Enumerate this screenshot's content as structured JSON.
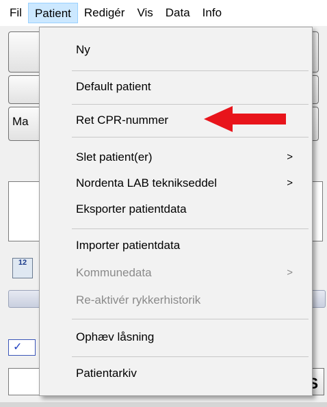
{
  "menubar": {
    "items": [
      {
        "label": "Fil"
      },
      {
        "label": "Patient"
      },
      {
        "label": "Redigér"
      },
      {
        "label": "Vis"
      },
      {
        "label": "Data"
      },
      {
        "label": "Info"
      }
    ]
  },
  "background": {
    "partial_label": "Ma",
    "icon_text": "12",
    "checkbox_glyph": "✓",
    "side_button_text": "S"
  },
  "patient_menu": {
    "items": [
      {
        "label": "Ny"
      },
      {
        "label": "Default patient"
      },
      {
        "label": "Ret CPR-nummer"
      },
      {
        "label": "Slet patient(er)",
        "submenu": ">"
      },
      {
        "label": "Nordenta LAB teknikseddel",
        "submenu": ">"
      },
      {
        "label": "Eksporter patientdata"
      },
      {
        "label": "Importer patientdata"
      },
      {
        "label": "Kommunedata",
        "submenu": ">"
      },
      {
        "label": "Re-aktivér rykkerhistorik"
      },
      {
        "label": "Ophæv låsning"
      },
      {
        "label": "Patientarkiv"
      }
    ]
  },
  "colors": {
    "arrow": "#e8141b",
    "active_menu_bg": "#cce8ff",
    "disabled_text": "#8a8a8a"
  }
}
